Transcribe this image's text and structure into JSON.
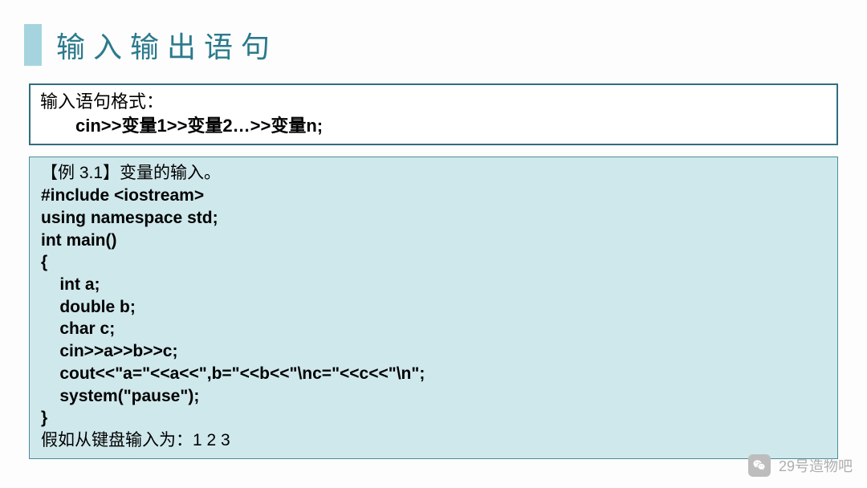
{
  "title": "输入输出语句",
  "format_box": {
    "heading": "输入语句格式：",
    "syntax": "cin>>变量1>>变量2…>>变量n;"
  },
  "example": {
    "heading": "【例 3.1】变量的输入。",
    "code": [
      "#include <iostream>",
      "using namespace std;",
      "int main()",
      "{",
      "    int a;",
      "    double b;",
      "    char c;",
      "    cin>>a>>b>>c;",
      "    cout<<\"a=\"<<a<<\",b=\"<<b<<\"\\nc=\"<<c<<\"\\n\";",
      "    system(\"pause\");",
      "}"
    ],
    "footer": "假如从键盘输入为：1  2  3"
  },
  "watermark": {
    "text": "29号造物吧"
  }
}
